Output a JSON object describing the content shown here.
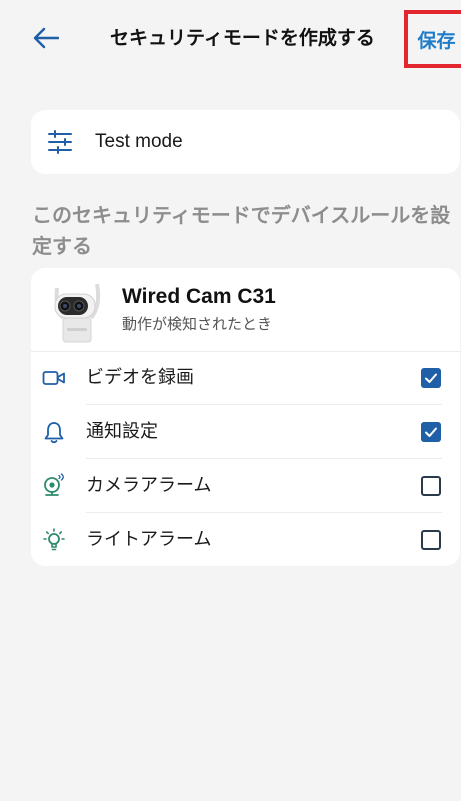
{
  "header": {
    "title": "セキュリティモードを作成する",
    "save_label": "保存",
    "accent_color": "#1f7cc9",
    "highlight_color": "#e3262d"
  },
  "mode": {
    "name": "Test mode",
    "icon": "sliders-icon"
  },
  "section_label": "このセキュリティモードでデバイスルールを設定する",
  "device": {
    "name": "Wired Cam C31",
    "trigger": "動作が検知されたとき",
    "rules": [
      {
        "label": "ビデオを録画",
        "icon": "video-camera-icon",
        "checked": true
      },
      {
        "label": "通知設定",
        "icon": "bell-icon",
        "checked": true
      },
      {
        "label": "カメラアラーム",
        "icon": "camera-alarm-icon",
        "checked": false
      },
      {
        "label": "ライトアラーム",
        "icon": "light-bulb-icon",
        "checked": false
      }
    ]
  },
  "colors": {
    "checkbox_checked": "#1f5fa8",
    "icon_blue": "#1f5fa8",
    "icon_green": "#2e8b6a",
    "section_gray": "#8d8d8d"
  }
}
